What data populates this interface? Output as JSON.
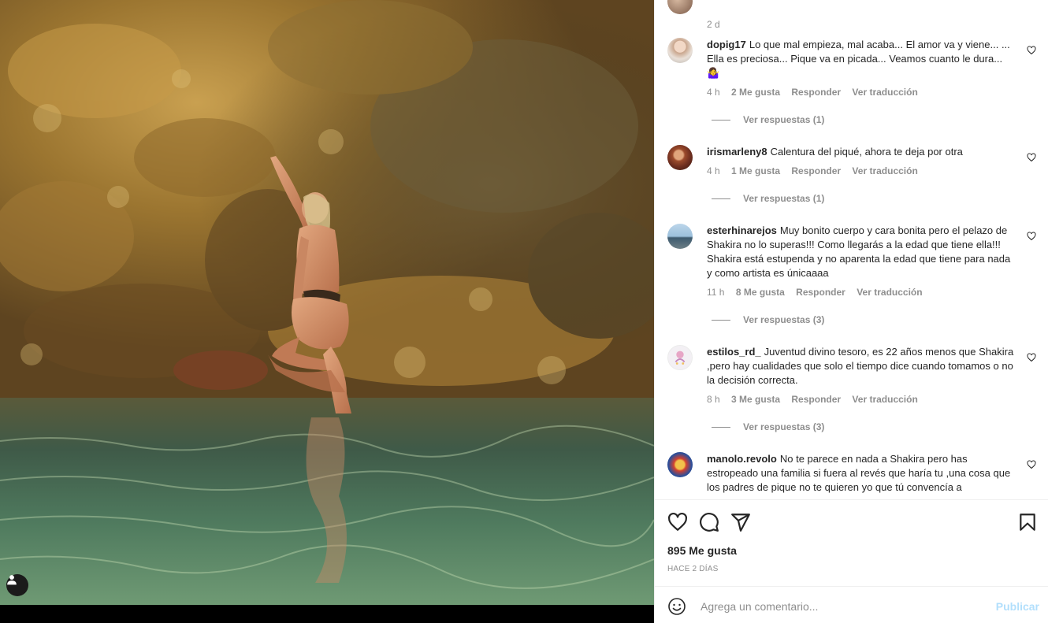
{
  "previous_comment": {
    "time": "2 d"
  },
  "comments": [
    {
      "username": "dopig17",
      "text": "Lo que mal empieza, mal acaba... El amor va y viene... ... Ella es preciosa... Pique va en picada... Veamos cuanto le dura... 🤷‍♀️",
      "time": "4 h",
      "likes": "2 Me gusta",
      "reply": "Responder",
      "translate": "Ver traducción",
      "replies": "Ver respuestas (1)"
    },
    {
      "username": "irismarleny8",
      "text": "Calentura del piqué, ahora te deja por otra",
      "time": "4 h",
      "likes": "1 Me gusta",
      "reply": "Responder",
      "translate": "Ver traducción",
      "replies": "Ver respuestas (1)"
    },
    {
      "username": "esterhinarejos",
      "text": "Muy bonito cuerpo y cara bonita pero el pelazo de Shakira no lo superas!!! Como llegarás a la edad que tiene ella!!! Shakira está estupenda y no aparenta la edad que tiene para nada y como artista es únicaaaa",
      "time": "11 h",
      "likes": "8 Me gusta",
      "reply": "Responder",
      "translate": "Ver traducción",
      "replies": "Ver respuestas (3)"
    },
    {
      "username": "estilos_rd_",
      "text": "Juventud divino tesoro, es 22 años menos que Shakira ,pero hay cualidades que solo el tiempo dice cuando tomamos o no la decisión correcta.",
      "time": "8 h",
      "likes": "3 Me gusta",
      "reply": "Responder",
      "translate": "Ver traducción",
      "replies": "Ver respuestas (3)"
    },
    {
      "username": "manolo.revolo",
      "text": "No te parece en nada a Shakira pero has estropeado una familia si fuera al revés que haría tu ,una cosa que los padres de pique no te quieren yo que tú convencía a"
    }
  ],
  "post": {
    "likes": "895 Me gusta",
    "date": "HACE 2 DÍAS"
  },
  "composer": {
    "placeholder": "Agrega un comentario...",
    "publish_label": "Publicar"
  },
  "icons": {
    "like": "heart-icon",
    "comment": "comment-icon",
    "share": "send-icon",
    "save": "bookmark-icon",
    "emoji": "emoji-icon",
    "tag": "user-tag-icon"
  },
  "colors": {
    "text": "#262626",
    "secondary": "#8e8e8e",
    "publish_disabled": "#b2dffc",
    "divider": "#efefef"
  }
}
